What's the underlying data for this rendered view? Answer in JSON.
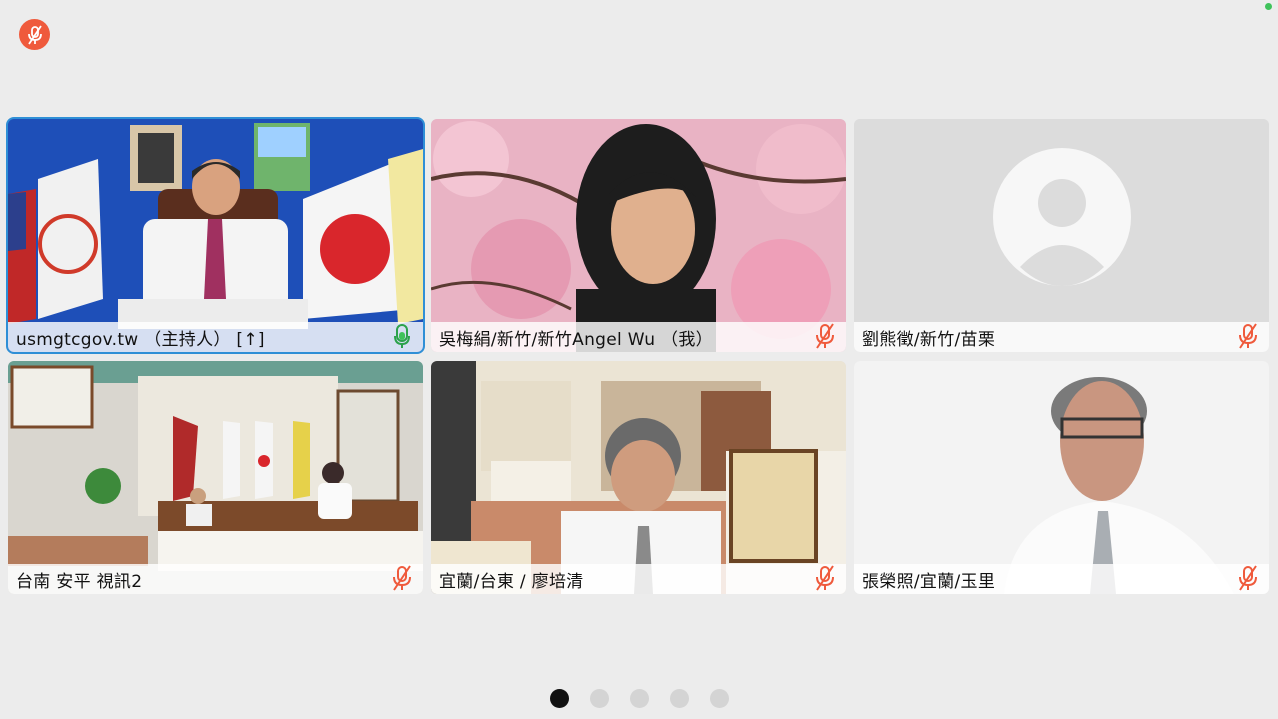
{
  "participants": [
    {
      "name": "usmgtcgov.tw （主持人） [↑]",
      "role": "host",
      "mic": "active",
      "bg": "#1f4fb5"
    },
    {
      "name": "吳梅絹/新竹/新竹Angel Wu （我）",
      "role": "self",
      "mic": "muted",
      "bg": "#e7a8bd"
    },
    {
      "name": "劉熊徵/新竹/苗栗",
      "role": "participant",
      "mic": "muted",
      "bg": "#dcdcdc"
    },
    {
      "name": "台南 安平 視訊2",
      "role": "participant",
      "mic": "muted",
      "bg": "#c9c7c0"
    },
    {
      "name": "宜蘭/台東 / 廖培清",
      "role": "participant",
      "mic": "muted",
      "bg": "#d8c7a6"
    },
    {
      "name": "張榮照/宜蘭/玉里",
      "role": "participant",
      "mic": "muted",
      "bg": "#f2f2f2"
    }
  ],
  "pager": {
    "pages": 5,
    "current": 1
  },
  "colors": {
    "muted_red": "#ef5a3c",
    "active_green": "#3fc25b",
    "active_border": "#2f8fd6"
  },
  "icons": {
    "top_left": "mic-muted-icon",
    "status": "connection-dot-icon",
    "tile_mic_muted": "mic-muted-icon",
    "tile_mic_active": "mic-active-icon"
  }
}
